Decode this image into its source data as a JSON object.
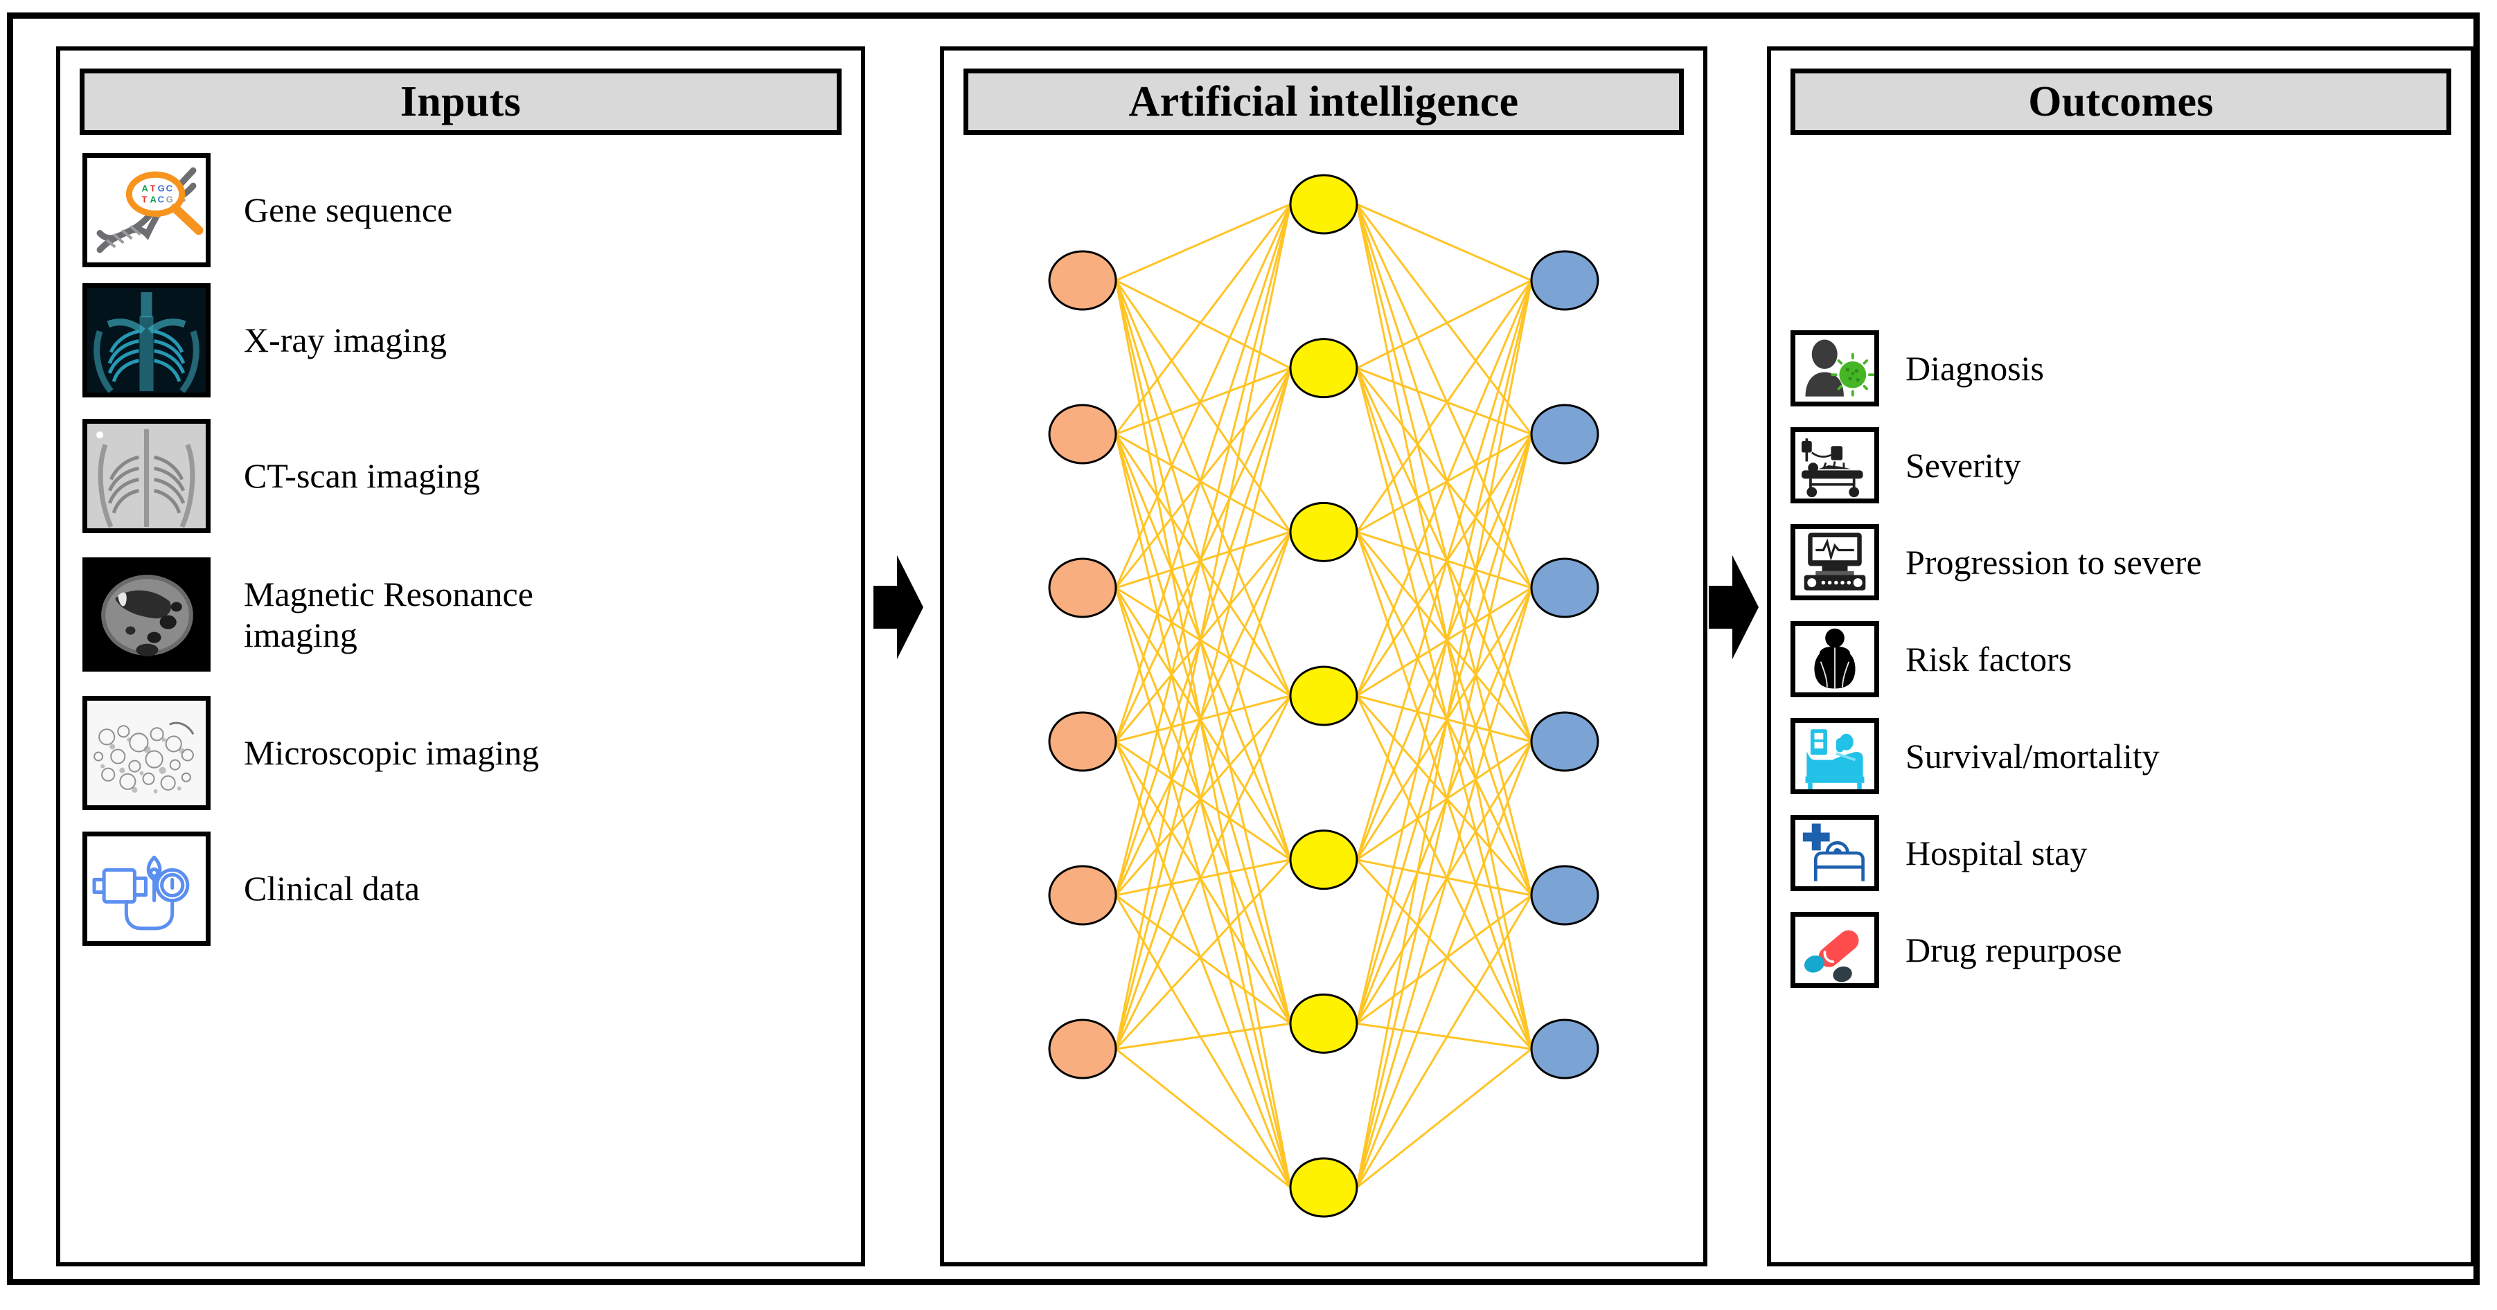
{
  "figure": {
    "panels": [
      {
        "id": "inputs",
        "title": "Inputs"
      },
      {
        "id": "ai",
        "title": "Artificial intelligence"
      },
      {
        "id": "outcomes",
        "title": "Outcomes"
      }
    ]
  },
  "inputs": {
    "title": "Inputs",
    "items": [
      {
        "label": "Gene sequence",
        "icon": "dna-magnifier-icon"
      },
      {
        "label": "X-ray imaging",
        "icon": "chest-xray-icon"
      },
      {
        "label": "CT-scan imaging",
        "icon": "ct-scan-icon"
      },
      {
        "label": "Magnetic Resonance\nimaging",
        "icon": "mri-scan-icon"
      },
      {
        "label": "Microscopic imaging",
        "icon": "microscopy-icon"
      },
      {
        "label": "Clinical data",
        "icon": "blood-pressure-monitor-icon"
      }
    ]
  },
  "ai": {
    "title": "Artificial intelligence",
    "network": {
      "input_layer_nodes": 6,
      "hidden_layer_nodes": 7,
      "output_layer_nodes": 6,
      "input_node_color": "#F9AE7F",
      "hidden_node_color": "#FFF200",
      "output_node_color": "#7BA3D4",
      "edge_color": "#FFC425",
      "node_outline_color": "#000000"
    }
  },
  "outcomes": {
    "title": "Outcomes",
    "items": [
      {
        "label": "Diagnosis",
        "icon": "patient-virus-icon"
      },
      {
        "label": "Severity",
        "icon": "hospital-gurney-icon"
      },
      {
        "label": "Progression to severe",
        "icon": "ecg-monitor-icon"
      },
      {
        "label": "Risk factors",
        "icon": "obesity-person-icon"
      },
      {
        "label": "Survival/mortality",
        "icon": "patient-in-bed-icon"
      },
      {
        "label": "Hospital stay",
        "icon": "hospital-bed-cross-icon"
      },
      {
        "label": "Drug repurpose",
        "icon": "pills-capsule-icon"
      }
    ]
  },
  "arrows": [
    {
      "name": "inputs-to-ai-arrow",
      "direction": "right"
    },
    {
      "name": "ai-to-outcomes-arrow",
      "direction": "right"
    }
  ],
  "colors": {
    "header_fill": "#D9D9D9",
    "border": "#000000",
    "background": "#FFFFFF",
    "accent_orange_node": "#F9AE7F",
    "accent_yellow_node": "#FFF200",
    "accent_blue_node": "#7BA3D4",
    "edge_yellow": "#FFC425"
  },
  "chart_data": {
    "type": "diagram",
    "title": "Artificial intelligence pipeline: inputs to outcomes",
    "layers": [
      {
        "name": "Inputs",
        "count": 6,
        "items": [
          "Gene sequence",
          "X-ray imaging",
          "CT-scan imaging",
          "Magnetic Resonance imaging",
          "Microscopic imaging",
          "Clinical data"
        ]
      },
      {
        "name": "Artificial intelligence",
        "count": 3,
        "items": [
          "input layer (6 nodes)",
          "hidden layer (7 nodes)",
          "output layer (6 nodes)"
        ]
      },
      {
        "name": "Outcomes",
        "count": 7,
        "items": [
          "Diagnosis",
          "Severity",
          "Progression to severe",
          "Risk factors",
          "Survival/mortality",
          "Hospital stay",
          "Drug repurpose"
        ]
      }
    ]
  }
}
